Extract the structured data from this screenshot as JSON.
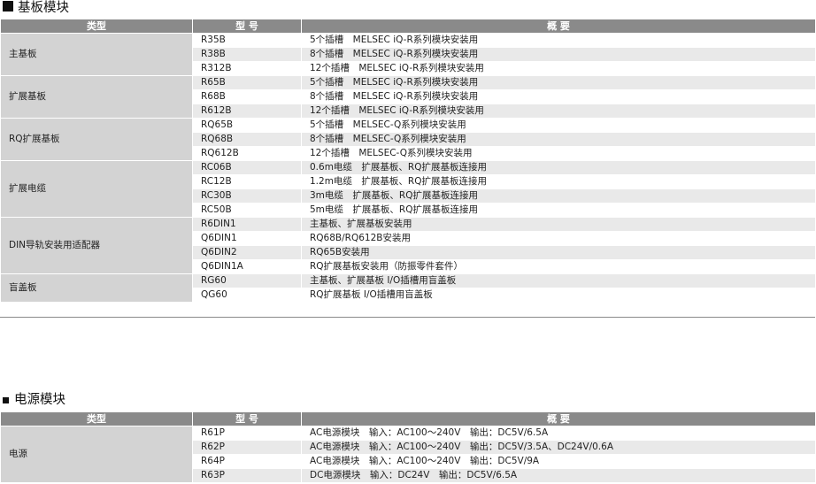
{
  "sections": [
    {
      "title": "基板模块",
      "headers": {
        "type": "类型",
        "model": "型 号",
        "desc": "概 要"
      },
      "groups": [
        {
          "category": "主基板",
          "rows": [
            {
              "model": "R35B",
              "desc": "5个插槽　MELSEC iQ-R系列模块安装用"
            },
            {
              "model": "R38B",
              "desc": "8个插槽　MELSEC iQ-R系列模块安装用"
            },
            {
              "model": "R312B",
              "desc": "12个插槽　MELSEC iQ-R系列模块安装用"
            }
          ]
        },
        {
          "category": "扩展基板",
          "rows": [
            {
              "model": "R65B",
              "desc": "5个插槽　MELSEC iQ-R系列模块安装用"
            },
            {
              "model": "R68B",
              "desc": "8个插槽　MELSEC iQ-R系列模块安装用"
            },
            {
              "model": "R612B",
              "desc": "12个插槽　MELSEC iQ-R系列模块安装用"
            }
          ]
        },
        {
          "category": "RQ扩展基板",
          "rows": [
            {
              "model": "RQ65B",
              "desc": "5个插槽　MELSEC-Q系列模块安装用"
            },
            {
              "model": "RQ68B",
              "desc": "8个插槽　MELSEC-Q系列模块安装用"
            },
            {
              "model": "RQ612B",
              "desc": "12个插槽　MELSEC-Q系列模块安装用"
            }
          ]
        },
        {
          "category": "扩展电缆",
          "rows": [
            {
              "model": "RC06B",
              "desc": "0.6m电缆　扩展基板、RQ扩展基板连接用"
            },
            {
              "model": "RC12B",
              "desc": "1.2m电缆　扩展基板、RQ扩展基板连接用"
            },
            {
              "model": "RC30B",
              "desc": "3m电缆　扩展基板、RQ扩展基板连接用"
            },
            {
              "model": "RC50B",
              "desc": "5m电缆　扩展基板、RQ扩展基板连接用"
            }
          ]
        },
        {
          "category": "DIN导轨安装用适配器",
          "rows": [
            {
              "model": "R6DIN1",
              "desc": "主基板、扩展基板安装用"
            },
            {
              "model": "Q6DIN1",
              "desc": "RQ68B/RQ612B安装用"
            },
            {
              "model": "Q6DIN2",
              "desc": "RQ65B安装用"
            },
            {
              "model": "Q6DIN1A",
              "desc": "RQ扩展基板安装用（防振零件套件）"
            }
          ]
        },
        {
          "category": "盲盖板",
          "rows": [
            {
              "model": "RG60",
              "desc": "主基板、扩展基板 I/O插槽用盲盖板"
            },
            {
              "model": "QG60",
              "desc": "RQ扩展基板 I/O插槽用盲盖板"
            }
          ]
        }
      ]
    },
    {
      "title": "电源模块",
      "headers": {
        "type": "类型",
        "model": "型 号",
        "desc": "概 要"
      },
      "groups": [
        {
          "category": "电源",
          "rows": [
            {
              "model": "R61P",
              "desc": "AC电源模块　输入：AC100～240V　输出：DC5V/6.5A"
            },
            {
              "model": "R62P",
              "desc": "AC电源模块　输入：AC100～240V　输出：DC5V/3.5A、DC24V/0.6A"
            },
            {
              "model": "R64P",
              "desc": "AC电源模块　输入：AC100～240V　输出：DC5V/9A"
            },
            {
              "model": "R63P",
              "desc": "DC电源模块　输入：DC24V　输出：DC5V/6.5A"
            }
          ]
        }
      ]
    }
  ]
}
